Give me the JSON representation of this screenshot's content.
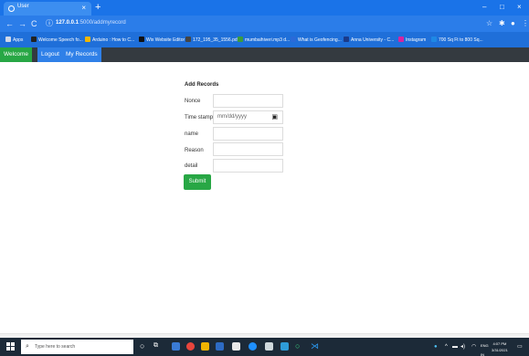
{
  "browser": {
    "tab_title": "User",
    "tab_close": "×",
    "new_tab": "+",
    "window_controls": {
      "minimize": "–",
      "maximize": "□",
      "close": "×"
    },
    "url_host": "127.0.0.1",
    "url_path": ":5000/addmyrecord",
    "bookmarks": [
      {
        "label": "Apps",
        "color": "#d0d8e8"
      },
      {
        "label": "Welcome Speech fo...",
        "color": "#222222"
      },
      {
        "label": "Arduino : How to C...",
        "color": "#f2b600"
      },
      {
        "label": "Wix Website Editor",
        "color": "#111111"
      },
      {
        "label": "172_195_35_1556.pdf",
        "color": "#444444"
      },
      {
        "label": "mumbaihiveri.mp3 d...",
        "color": "#3c9c3c"
      },
      {
        "label": "What is Geofencing...",
        "color": "#2a6ad8"
      },
      {
        "label": "Anna University - C...",
        "color": "#1a3a8a"
      },
      {
        "label": "Instagram",
        "color": "#d6249f"
      },
      {
        "label": "700 Sq Ft to 800 Sq...",
        "color": "#1e88e5"
      }
    ]
  },
  "nav": {
    "welcome": "Welcome",
    "logout": "Logout",
    "my_records": "My Records"
  },
  "form": {
    "heading": "Add Records",
    "fields": [
      {
        "label": "Nonce",
        "value": ""
      },
      {
        "label": "Time stamp",
        "value": "mm/dd/yyyy"
      },
      {
        "label": "name",
        "value": ""
      },
      {
        "label": "Reason",
        "value": ""
      },
      {
        "label": "detail",
        "value": ""
      }
    ],
    "submit": "Submit"
  },
  "taskbar": {
    "search_placeholder": "Type here to search",
    "lang": "ENG",
    "region": "IN",
    "time": "4:07 PM",
    "date": "3/31/2021"
  },
  "colors": {
    "chrome_blue": "#1a73e8",
    "navbar": "#343a40",
    "active_green": "#28a745",
    "link_blue": "#2f80e8"
  }
}
